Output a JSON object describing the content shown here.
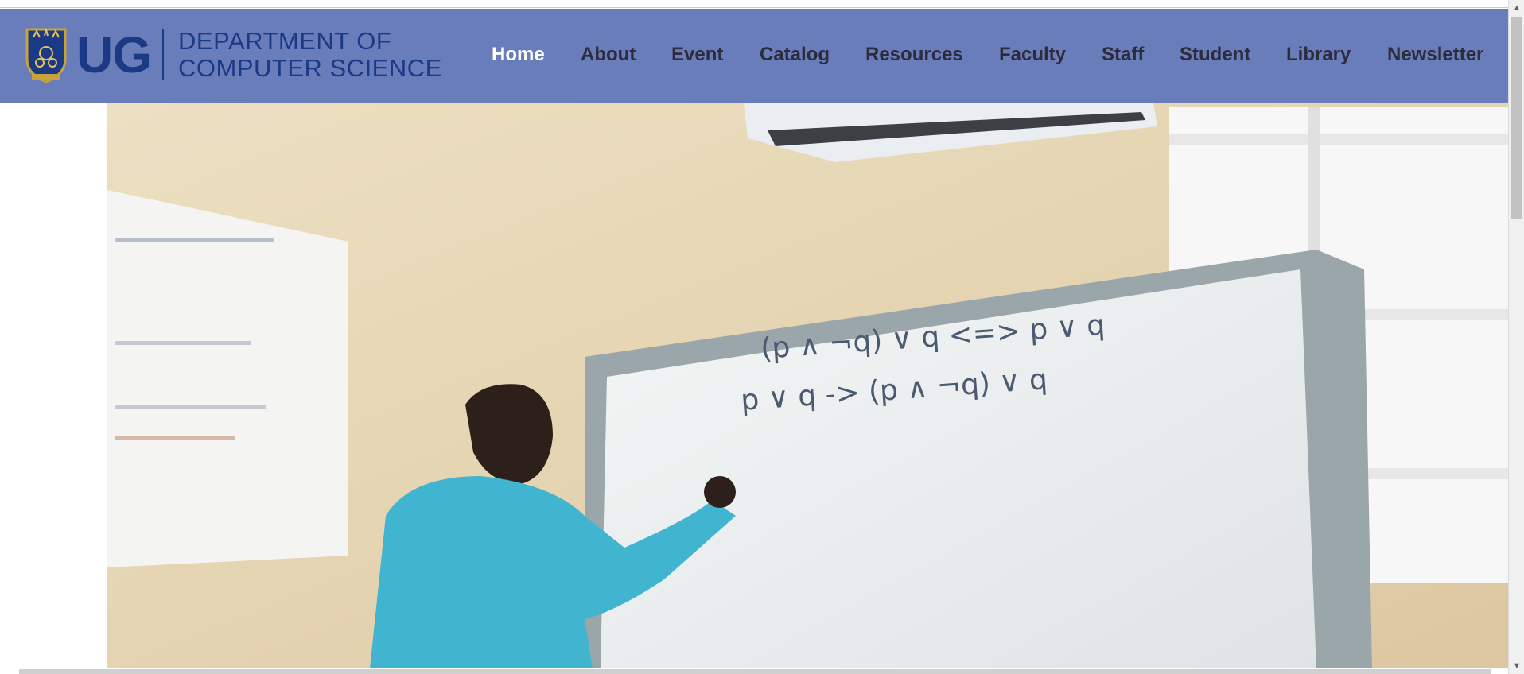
{
  "brand": {
    "abbrev": "UG",
    "dept_line1": "DEPARTMENT OF",
    "dept_line2": "COMPUTER SCIENCE",
    "crest_icon": "university-crest-icon",
    "color": "#1b3a86"
  },
  "nav": {
    "items": [
      {
        "label": "Home",
        "active": true
      },
      {
        "label": "About"
      },
      {
        "label": "Event"
      },
      {
        "label": "Catalog"
      },
      {
        "label": "Resources"
      },
      {
        "label": "Faculty"
      },
      {
        "label": "Staff"
      },
      {
        "label": "Student"
      },
      {
        "label": "Library"
      },
      {
        "label": "Newsletter"
      }
    ],
    "background": "#6a7dbb"
  },
  "hero": {
    "board_line1": "(p ∧ ¬q) ∨ q  <=>  p ∨ q",
    "board_line2": "p ∨ q  ->  (p ∧ ¬q) ∨ q"
  }
}
